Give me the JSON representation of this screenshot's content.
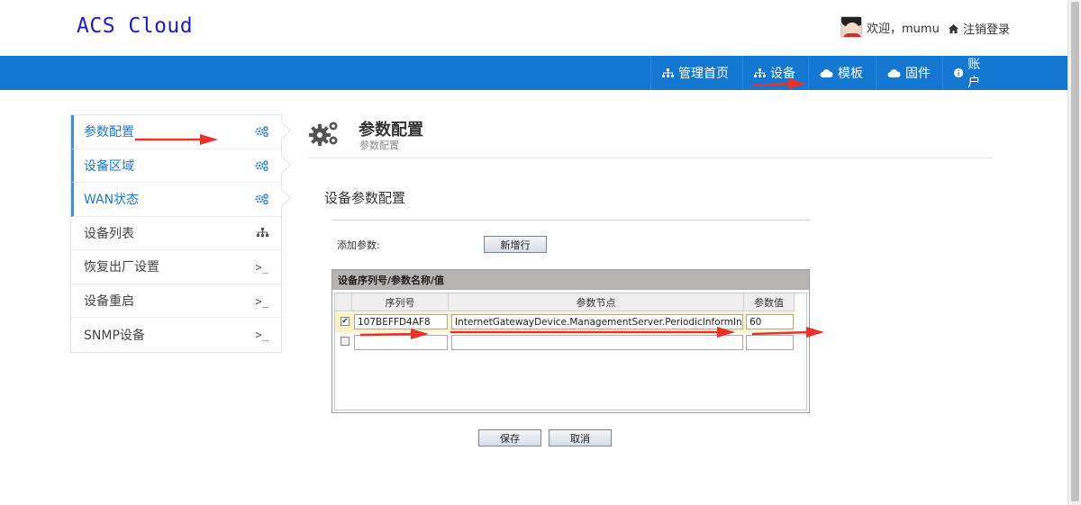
{
  "header": {
    "logo": "ACS Cloud",
    "welcome": "欢迎，mumu",
    "logout": "注销登录"
  },
  "nav": {
    "items": [
      {
        "label": "管理首页",
        "icon": "sitemap-icon"
      },
      {
        "label": "设备",
        "icon": "sitemap-icon"
      },
      {
        "label": "模板",
        "icon": "cloud-icon"
      },
      {
        "label": "固件",
        "icon": "cloud-icon"
      },
      {
        "label": "账户",
        "icon": "info-icon"
      }
    ]
  },
  "sidebar": {
    "items": [
      {
        "label": "参数配置",
        "icon": "gears-icon",
        "active": true
      },
      {
        "label": "设备区域",
        "icon": "gears-icon",
        "active": true
      },
      {
        "label": "WAN状态",
        "icon": "gears-icon",
        "active": true
      },
      {
        "label": "设备列表",
        "icon": "sitemap-icon",
        "active": false
      },
      {
        "label": "恢复出厂设置",
        "icon": "terminal-icon",
        "active": false
      },
      {
        "label": "设备重启",
        "icon": "terminal-icon",
        "active": false
      },
      {
        "label": "SNMP设备",
        "icon": "terminal-icon",
        "active": false
      }
    ],
    "terminal_glyph": ">_"
  },
  "page": {
    "title": "参数配置",
    "subtitle": "参数配置",
    "section_title": "设备参数配置",
    "add_label": "添加参数:",
    "add_button": "新增行",
    "save_button": "保存",
    "cancel_button": "取消"
  },
  "grid": {
    "title": "设备序列号/参数名称/值",
    "columns": [
      "序列号",
      "参数节点",
      "参数值"
    ],
    "rows": [
      {
        "checked": true,
        "serial": "107BEFFD4AF8",
        "node": "InternetGatewayDevice.ManagementServer.PeriodicInformInterval",
        "value": "60"
      },
      {
        "checked": false,
        "serial": "",
        "node": "",
        "value": ""
      }
    ]
  },
  "colors": {
    "navbar": "#1478d2",
    "logo": "#1a1ad6",
    "sidebar_active": "#1e78d4",
    "annotation_arrow": "#e8322b"
  }
}
